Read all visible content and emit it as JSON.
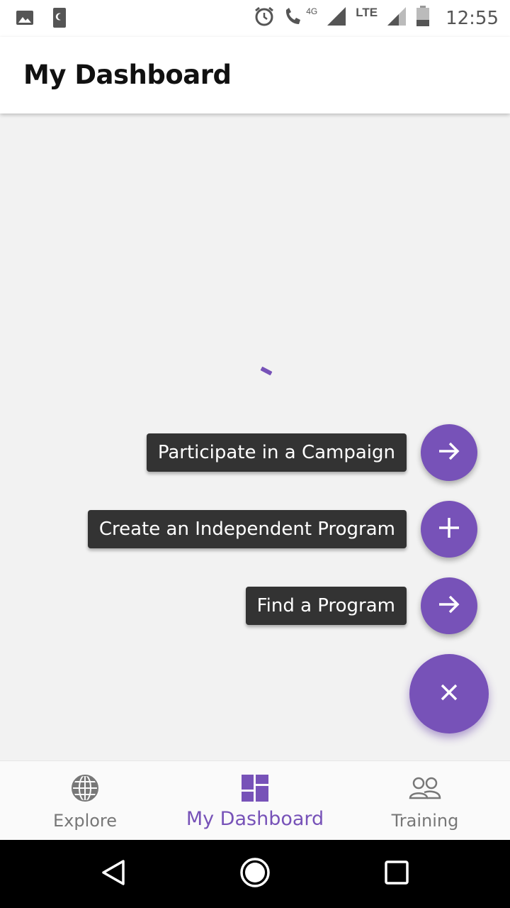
{
  "status_bar": {
    "time": "12:55",
    "network_label": "LTE",
    "data_label": "4G",
    "icons": [
      "image-icon",
      "phone-icon",
      "alarm-icon",
      "wifi-call-icon",
      "signal-icon",
      "signal-icon",
      "battery-icon"
    ]
  },
  "app_bar": {
    "title": "My Dashboard"
  },
  "speed_dial": {
    "actions": [
      {
        "label": "Participate in a Campaign",
        "icon": "arrow-right-icon"
      },
      {
        "label": "Create an Independent Program",
        "icon": "plus-icon"
      },
      {
        "label": "Find a Program",
        "icon": "arrow-right-icon"
      }
    ],
    "main_icon": "close-icon"
  },
  "bottom_nav": {
    "items": [
      {
        "label": "Explore",
        "icon": "globe-icon",
        "active": false
      },
      {
        "label": "My Dashboard",
        "icon": "dashboard-icon",
        "active": true
      },
      {
        "label": "Training",
        "icon": "people-icon",
        "active": false
      }
    ]
  },
  "colors": {
    "accent": "#7752b8",
    "label_bg": "#333333",
    "background": "#f2f2f2"
  }
}
